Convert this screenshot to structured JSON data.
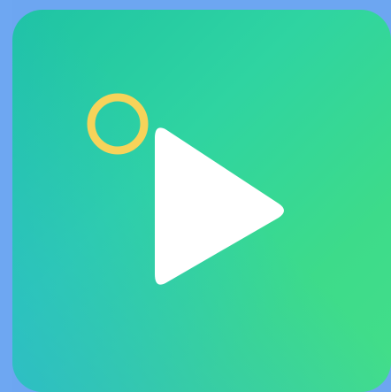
{
  "app": {
    "icon": "play-icon",
    "accent_colors": {
      "gradient_start": "#1fc3a4",
      "gradient_end": "#43de89",
      "bottom_tint": "#29aae6",
      "play_fill": "#ffffff",
      "ring_color": "#f6d35a",
      "background": "#6da6f1"
    }
  },
  "overlay": {
    "icon": "highlight-ring-icon"
  }
}
